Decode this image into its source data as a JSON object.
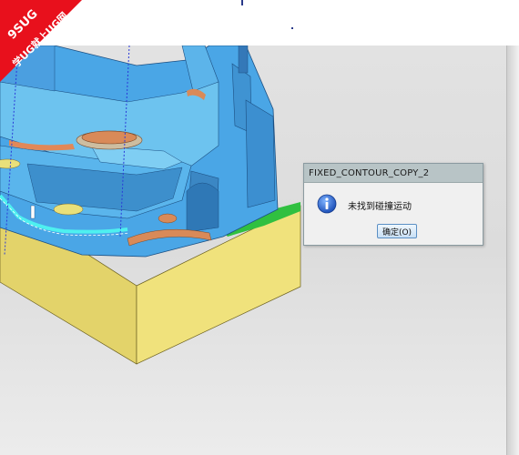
{
  "watermark": {
    "line1": "9SUG",
    "line2": "学UG就上UG网",
    "color": "#e8101c"
  },
  "dialog": {
    "title": "FIXED_CONTOUR_COPY_2",
    "icon": "info-icon",
    "message": "未找到碰撞运动",
    "ok_label": "确定(O)"
  },
  "colors": {
    "part_face": "#4aa6e6",
    "part_top": "#6dc3ef",
    "toolpath": "#4ef0f0",
    "stock": "#e3d36a",
    "viewport_background": "#dedede"
  }
}
